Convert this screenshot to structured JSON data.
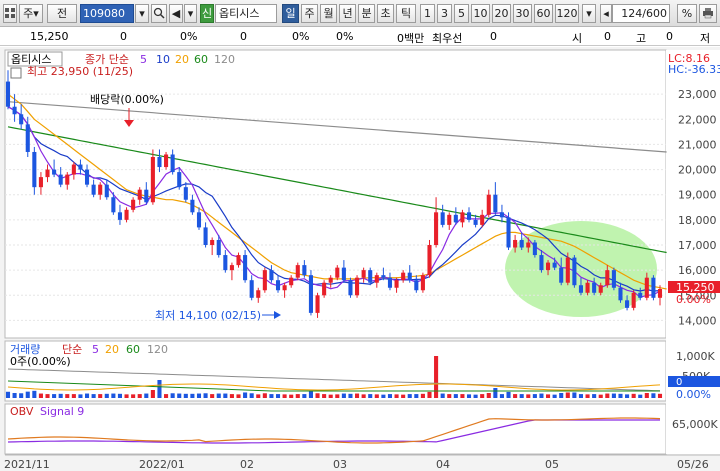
{
  "toolbar": {
    "market_label": "주",
    "all_label": "전",
    "stock_code": "109080",
    "credit_label": "신",
    "stock_name": "옵티시스",
    "periods": [
      "일",
      "주",
      "월",
      "년",
      "분",
      "초",
      "틱"
    ],
    "intervals": [
      "1",
      "3",
      "5",
      "10",
      "20",
      "30",
      "60",
      "120"
    ],
    "count": "124",
    "count_total": "/600"
  },
  "info": {
    "price": "15,250",
    "v1": "0",
    "v2": "0%",
    "v3": "0",
    "v4": "0%",
    "v5": "0%",
    "volume_unit": "0백만",
    "best_bid_label": "최우선",
    "best_bid": "0",
    "open_label": "시",
    "open": "0",
    "high_label": "고",
    "high": "0",
    "low_label": "저"
  },
  "colors": {
    "up": "#e8202a",
    "down": "#1c56e0",
    "ma5": "#8a2be2",
    "ma10": "#1a3cc8",
    "ma20": "#f0a000",
    "ma60": "#1a8a1a",
    "ma120": "#8c8c8c",
    "highlight": "#b9f2a6"
  },
  "price_panel": {
    "stock_label": "옵티시스",
    "series_label": "종가 단순",
    "ma_labels": [
      "5",
      "10",
      "20",
      "60",
      "120"
    ],
    "max_annotation": "최고 23,950 (11/25)",
    "min_annotation": "최저 14,100 (02/15)",
    "dividend_annotation": "배당락(0.00%)",
    "lc_label": "LC:8.16",
    "hc_label": "HC:-36.33",
    "current_price": "15,250",
    "current_change": "0.00%",
    "y_ticks": [
      "23,000",
      "22,000",
      "21,000",
      "20,000",
      "19,000",
      "18,000",
      "17,000",
      "16,000",
      "15,000",
      "14,000"
    ]
  },
  "volume_panel": {
    "title": "거래량",
    "series_label": "단순",
    "ma_labels": [
      "5",
      "20",
      "60",
      "120"
    ],
    "sub_label": "0주(0.00%)",
    "y_ticks": [
      "1,000K",
      "500K"
    ],
    "current": "0",
    "current_pct": "0.00%"
  },
  "obv_panel": {
    "title": "OBV",
    "signal_label": "Signal 9",
    "y_tick": "65,000K"
  },
  "x_axis": {
    "labels": [
      "2021/11",
      "2022/01",
      "02",
      "03",
      "04",
      "05",
      "05/26"
    ]
  },
  "chart_data": {
    "type": "candlestick",
    "period": "daily",
    "y_range": [
      13500,
      24000
    ],
    "candles": [
      [
        23500,
        23950,
        22400,
        22500
      ],
      [
        22500,
        23000,
        21900,
        22200
      ],
      [
        22200,
        22600,
        21600,
        21800
      ],
      [
        21800,
        22100,
        20500,
        20700
      ],
      [
        20700,
        20900,
        19000,
        19300
      ],
      [
        19300,
        19900,
        19000,
        19700
      ],
      [
        19700,
        20200,
        19500,
        20000
      ],
      [
        20000,
        20400,
        19700,
        19800
      ],
      [
        19800,
        20100,
        19300,
        19400
      ],
      [
        19400,
        19900,
        19200,
        19800
      ],
      [
        19800,
        20300,
        19600,
        20200
      ],
      [
        20200,
        20400,
        19800,
        20000
      ],
      [
        20000,
        20200,
        19300,
        19400
      ],
      [
        19400,
        19600,
        18900,
        19000
      ],
      [
        19000,
        19500,
        18800,
        19400
      ],
      [
        19400,
        19600,
        18800,
        18900
      ],
      [
        18900,
        19100,
        18200,
        18300
      ],
      [
        18300,
        18600,
        17800,
        18000
      ],
      [
        18000,
        18500,
        17900,
        18400
      ],
      [
        18400,
        18900,
        18300,
        18800
      ],
      [
        18800,
        19300,
        18600,
        19200
      ],
      [
        19200,
        19500,
        18600,
        18700
      ],
      [
        18700,
        20800,
        18600,
        20500
      ],
      [
        20500,
        20800,
        19900,
        20100
      ],
      [
        20100,
        20700,
        20000,
        20600
      ],
      [
        20600,
        20800,
        19800,
        19900
      ],
      [
        19900,
        20100,
        19200,
        19300
      ],
      [
        19300,
        19500,
        18700,
        18800
      ],
      [
        18800,
        19000,
        18200,
        18300
      ],
      [
        18300,
        18500,
        17600,
        17700
      ],
      [
        17700,
        17900,
        16900,
        17000
      ],
      [
        17000,
        17300,
        16600,
        17200
      ],
      [
        17200,
        17400,
        16500,
        16600
      ],
      [
        16600,
        16800,
        15900,
        16000
      ],
      [
        16000,
        16300,
        15600,
        16200
      ],
      [
        16200,
        16700,
        16100,
        16600
      ],
      [
        16600,
        16800,
        15500,
        15600
      ],
      [
        15600,
        15800,
        14800,
        14900
      ],
      [
        14900,
        15300,
        14700,
        15200
      ],
      [
        15200,
        16100,
        15100,
        16000
      ],
      [
        16000,
        16200,
        15500,
        15600
      ],
      [
        15600,
        15800,
        15100,
        15200
      ],
      [
        15200,
        15500,
        14900,
        15400
      ],
      [
        15400,
        15800,
        15300,
        15700
      ],
      [
        15700,
        16300,
        15600,
        16200
      ],
      [
        16200,
        16400,
        15700,
        15800
      ],
      [
        15800,
        16000,
        14200,
        14300
      ],
      [
        14300,
        15100,
        14100,
        15000
      ],
      [
        15000,
        15600,
        14900,
        15500
      ],
      [
        15500,
        15800,
        15300,
        15700
      ],
      [
        15700,
        16200,
        15600,
        16100
      ],
      [
        16100,
        16400,
        15500,
        15600
      ],
      [
        15600,
        15700,
        14900,
        15000
      ],
      [
        15000,
        15800,
        14900,
        15700
      ],
      [
        15700,
        16100,
        15500,
        16000
      ],
      [
        16000,
        16100,
        15400,
        15500
      ],
      [
        15500,
        15900,
        15300,
        15800
      ],
      [
        15800,
        16100,
        15600,
        15700
      ],
      [
        15700,
        15900,
        15200,
        15300
      ],
      [
        15300,
        15700,
        15100,
        15600
      ],
      [
        15600,
        16000,
        15500,
        15900
      ],
      [
        15900,
        16200,
        15500,
        15600
      ],
      [
        15600,
        15800,
        15100,
        15200
      ],
      [
        15200,
        15900,
        15100,
        15800
      ],
      [
        15800,
        17200,
        15700,
        17000
      ],
      [
        17000,
        18900,
        16900,
        18300
      ],
      [
        18300,
        18600,
        17700,
        17800
      ],
      [
        17800,
        18300,
        17600,
        18200
      ],
      [
        18200,
        18500,
        17800,
        17900
      ],
      [
        17900,
        18400,
        17700,
        18300
      ],
      [
        18300,
        18500,
        17900,
        18000
      ],
      [
        18000,
        18200,
        17700,
        17800
      ],
      [
        17800,
        18400,
        17700,
        18200
      ],
      [
        18200,
        19200,
        18100,
        19000
      ],
      [
        19000,
        19500,
        18200,
        18300
      ],
      [
        18300,
        18600,
        17900,
        18100
      ],
      [
        18100,
        18300,
        16800,
        16900
      ],
      [
        16900,
        17400,
        16700,
        17200
      ],
      [
        17200,
        17500,
        16800,
        16900
      ],
      [
        16900,
        17300,
        16700,
        17100
      ],
      [
        17100,
        17200,
        16500,
        16600
      ],
      [
        16600,
        16800,
        15900,
        16000
      ],
      [
        16000,
        16400,
        15800,
        16300
      ],
      [
        16300,
        16500,
        16000,
        16100
      ],
      [
        16100,
        16500,
        15400,
        15500
      ],
      [
        15500,
        16700,
        15400,
        16500
      ],
      [
        16500,
        16600,
        15300,
        15400
      ],
      [
        15400,
        15700,
        15000,
        15100
      ],
      [
        15100,
        15600,
        15000,
        15500
      ],
      [
        15500,
        15700,
        15000,
        15100
      ],
      [
        15100,
        15500,
        15000,
        15400
      ],
      [
        15400,
        16200,
        15300,
        16000
      ],
      [
        16000,
        16100,
        15200,
        15300
      ],
      [
        15300,
        15500,
        14700,
        14800
      ],
      [
        14800,
        15000,
        14400,
        14500
      ],
      [
        14500,
        15200,
        14400,
        15100
      ],
      [
        15100,
        15300,
        14800,
        14900
      ],
      [
        14900,
        15900,
        14800,
        15700
      ],
      [
        15700,
        15800,
        14800,
        14900
      ],
      [
        14900,
        15400,
        14600,
        15250
      ]
    ],
    "ma20": [
      23000,
      22800,
      22600,
      22300,
      22000,
      21800,
      21600,
      21400,
      21200,
      21000,
      20800,
      20600,
      20400,
      20200,
      20000,
      19800,
      19600,
      19400,
      19200,
      19100,
      19000,
      18950,
      18900,
      18850,
      18800,
      18800,
      18750,
      18700,
      18600,
      18450,
      18300,
      18100,
      17900,
      17700,
      17500,
      17300,
      17100,
      16900,
      16700,
      16500,
      16300,
      16150,
      16000,
      15900,
      15850,
      15800,
      15750,
      15700,
      15650,
      15650,
      15650,
      15650,
      15650,
      15650,
      15680,
      15700,
      15700,
      15700,
      15700,
      15700,
      15720,
      15740,
      15760,
      15790,
      15850,
      16000,
      16150,
      16300,
      16450,
      16600,
      16750,
      16900,
      17050,
      17200,
      17350,
      17450,
      17500,
      17500,
      17450,
      17400,
      17350,
      17300,
      17250,
      17200,
      17150,
      17050,
      16950,
      16800,
      16650,
      16500,
      16350,
      16200,
      16050,
      15900,
      15750,
      15600,
      15500,
      15400,
      15350,
      15300,
      15250
    ],
    "ma60": [
      21700,
      21650,
      21600,
      21550,
      21500,
      21450,
      21400,
      21350,
      21300,
      21250,
      21200,
      21150,
      21100,
      21050,
      21000,
      20950,
      20900,
      20850,
      20800,
      20750,
      20700,
      20650,
      20600,
      20550,
      20500,
      20450,
      20400,
      20350,
      20300,
      20250,
      20200,
      20150,
      20100,
      20050,
      20000,
      19950,
      19900,
      19850,
      19800,
      19750,
      19700,
      19650,
      19600,
      19550,
      19500,
      19450,
      19400,
      19350,
      19300,
      19250,
      19200,
      19150,
      19100,
      19050,
      19000,
      18950,
      18900,
      18850,
      18800,
      18750,
      18700,
      18650,
      18600,
      18550,
      18500,
      18450,
      18400,
      18350,
      18300,
      18250,
      18200,
      18150,
      18100,
      18050,
      18000,
      17950,
      17900,
      17850,
      17800,
      17750,
      17700,
      17650,
      17600,
      17550,
      17500,
      17450,
      17400,
      17350,
      17300,
      17250,
      17200,
      17150,
      17100,
      17050,
      17000,
      16950,
      16900,
      16850,
      16800,
      16750,
      16700
    ],
    "ma120": [
      22700,
      22680,
      22660,
      22640,
      22620,
      22600,
      22580,
      22560,
      22540,
      22520,
      22500,
      22480,
      22460,
      22440,
      22420,
      22400,
      22380,
      22360,
      22340,
      22320,
      22300,
      22280,
      22260,
      22240,
      22220,
      22200,
      22180,
      22160,
      22140,
      22120,
      22100,
      22080,
      22060,
      22040,
      22020,
      22000,
      21980,
      21960,
      21940,
      21920,
      21900,
      21880,
      21860,
      21840,
      21820,
      21800,
      21780,
      21760,
      21740,
      21720,
      21700,
      21680,
      21660,
      21640,
      21620,
      21600,
      21580,
      21560,
      21540,
      21520,
      21500,
      21480,
      21460,
      21440,
      21420,
      21400,
      21380,
      21360,
      21340,
      21320,
      21300,
      21280,
      21260,
      21240,
      21220,
      21200,
      21180,
      21160,
      21140,
      21120,
      21100,
      21080,
      21060,
      21040,
      21020,
      21000,
      20980,
      20960,
      20940,
      20920,
      20900,
      20880,
      20860,
      20840,
      20820,
      20800,
      20780,
      20760,
      20740,
      20720,
      20700
    ]
  }
}
